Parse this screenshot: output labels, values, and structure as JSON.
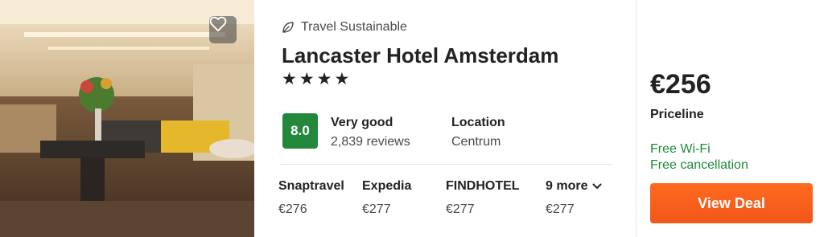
{
  "hotel": {
    "sustainability_label": "Travel Sustainable",
    "name": "Lancaster Hotel Amsterdam",
    "stars": "★★★★",
    "star_count": 4,
    "rating": {
      "score": "8.0",
      "label": "Very good",
      "reviews": "2,839 reviews",
      "badge_color": "#23883c"
    },
    "location": {
      "label": "Location",
      "value": "Centrum"
    }
  },
  "providers": [
    {
      "name": "Snaptravel",
      "price": "€276"
    },
    {
      "name": "Expedia",
      "price": "€277"
    },
    {
      "name": "FINDHOTEL",
      "price": "€277"
    }
  ],
  "more": {
    "label": "9 more",
    "price": "€277"
  },
  "deal": {
    "price": "€256",
    "provider": "Priceline",
    "amenities": [
      "Free Wi-Fi",
      "Free cancellation"
    ],
    "button_label": "View Deal",
    "button_color": "#f2551a",
    "amenity_color": "#1f8a3a"
  },
  "icons": {
    "favorite": "heart-icon",
    "sustainable": "leaf-icon",
    "more": "chevron-down-icon"
  }
}
